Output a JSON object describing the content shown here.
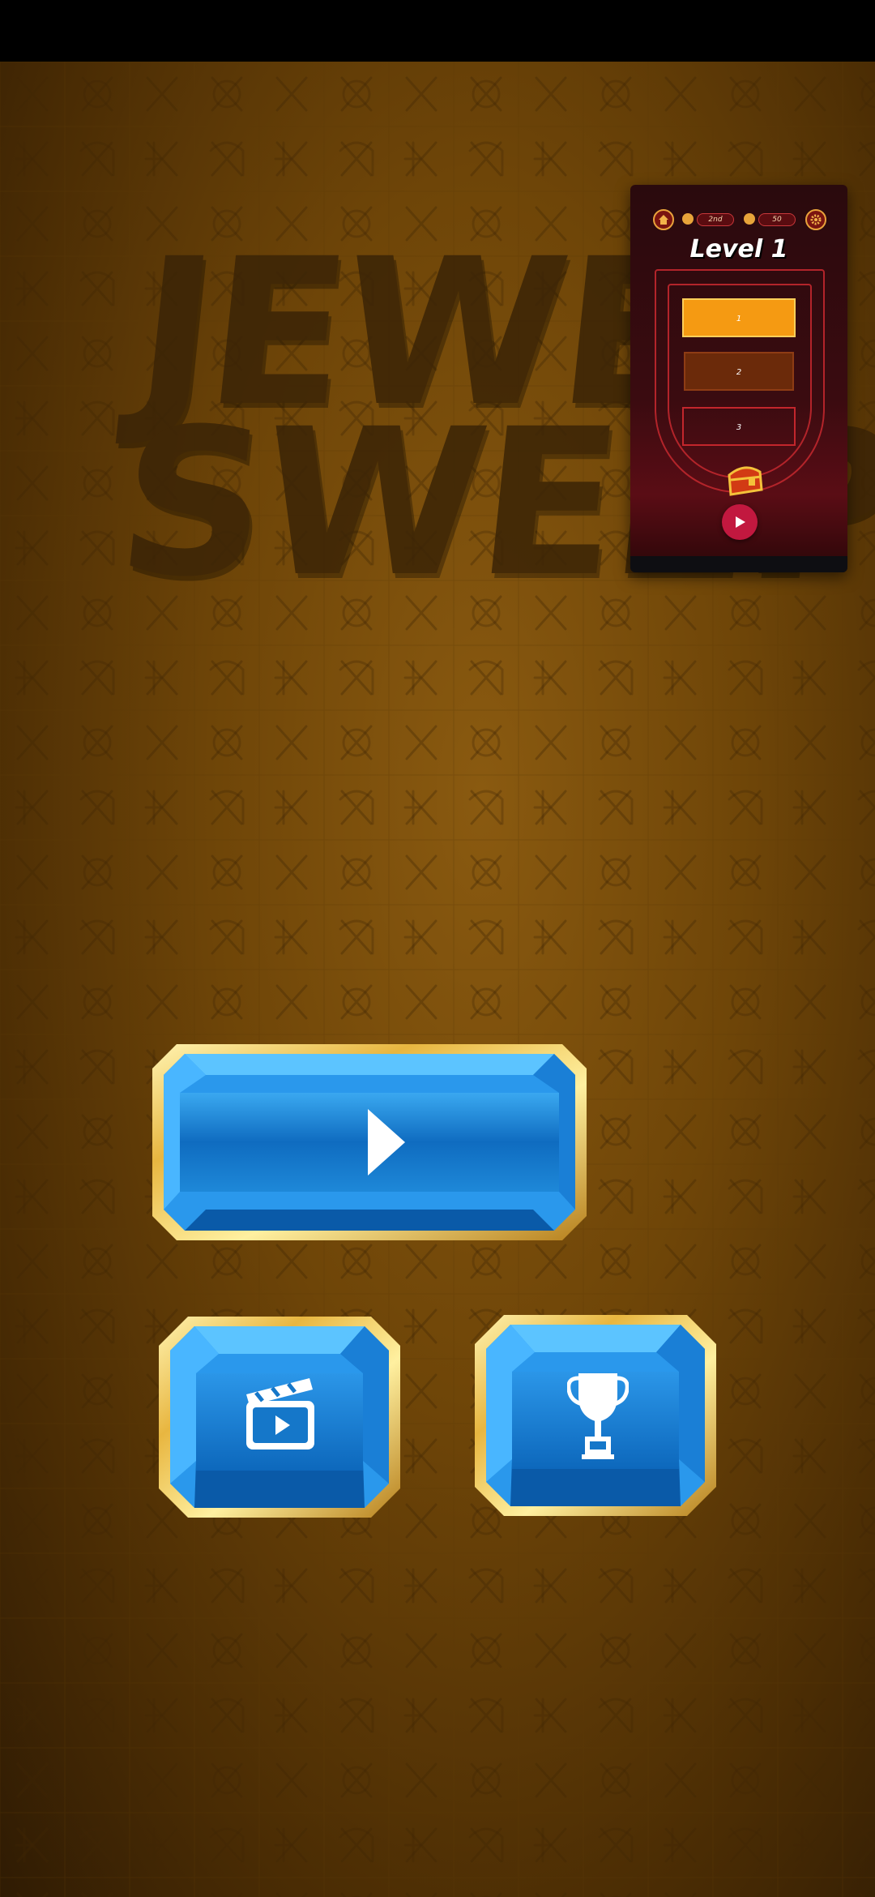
{
  "game": {
    "title_line1": "JEWEL",
    "title_line2": "SWEEP"
  },
  "preview": {
    "rank_value": "2nd",
    "coins_value": "50",
    "level_title": "Level 1",
    "levels": [
      "1",
      "2",
      "3"
    ]
  },
  "icons": {
    "home": "home-icon",
    "settings": "gear-icon",
    "play": "play-icon",
    "video": "clapperboard-icon",
    "trophy": "trophy-icon",
    "chest": "treasure-chest-icon"
  },
  "colors": {
    "gem_blue": "#1e88d8",
    "gold_frame": "#e8b640",
    "preview_bg": "#3a0b10",
    "active_level": "#f59a12"
  }
}
